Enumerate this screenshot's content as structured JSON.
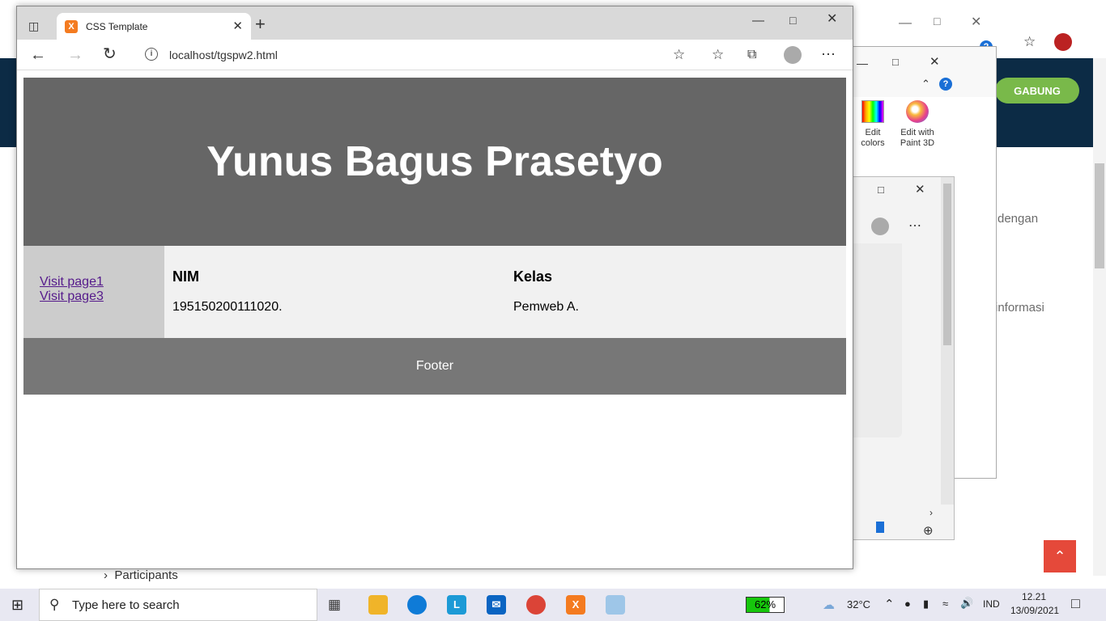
{
  "browser": {
    "tab_title": "CSS Template",
    "favicon_glyph": "X",
    "url": "localhost/tgspw2.html"
  },
  "page": {
    "header_title": "Yunus Bagus Prasetyo",
    "nav_links": [
      "Visit page1",
      "Visit page3"
    ],
    "columns": [
      {
        "heading": "NIM",
        "value": "195150200111020."
      },
      {
        "heading": "Kelas",
        "value": "Pemweb A."
      }
    ],
    "footer": "Footer"
  },
  "background": {
    "join_button": "GABUNG",
    "snippet_1": "dengan",
    "snippet_2": "si informasi",
    "menu_item": "Participants"
  },
  "paint": {
    "edit_colors": "Edit colors",
    "edit_paint3d": "Edit with Paint 3D"
  },
  "taskbar": {
    "search_placeholder": "Type here to search",
    "battery": "62%",
    "temperature": "32°C",
    "language": "IND",
    "time": "12.21",
    "date": "13/09/2021"
  },
  "colors": {
    "header_bg": "#666666",
    "footer_bg": "#777777",
    "nav_bg": "#cccccc",
    "content_bg": "#f1f1f1",
    "link": "#551a8b"
  }
}
